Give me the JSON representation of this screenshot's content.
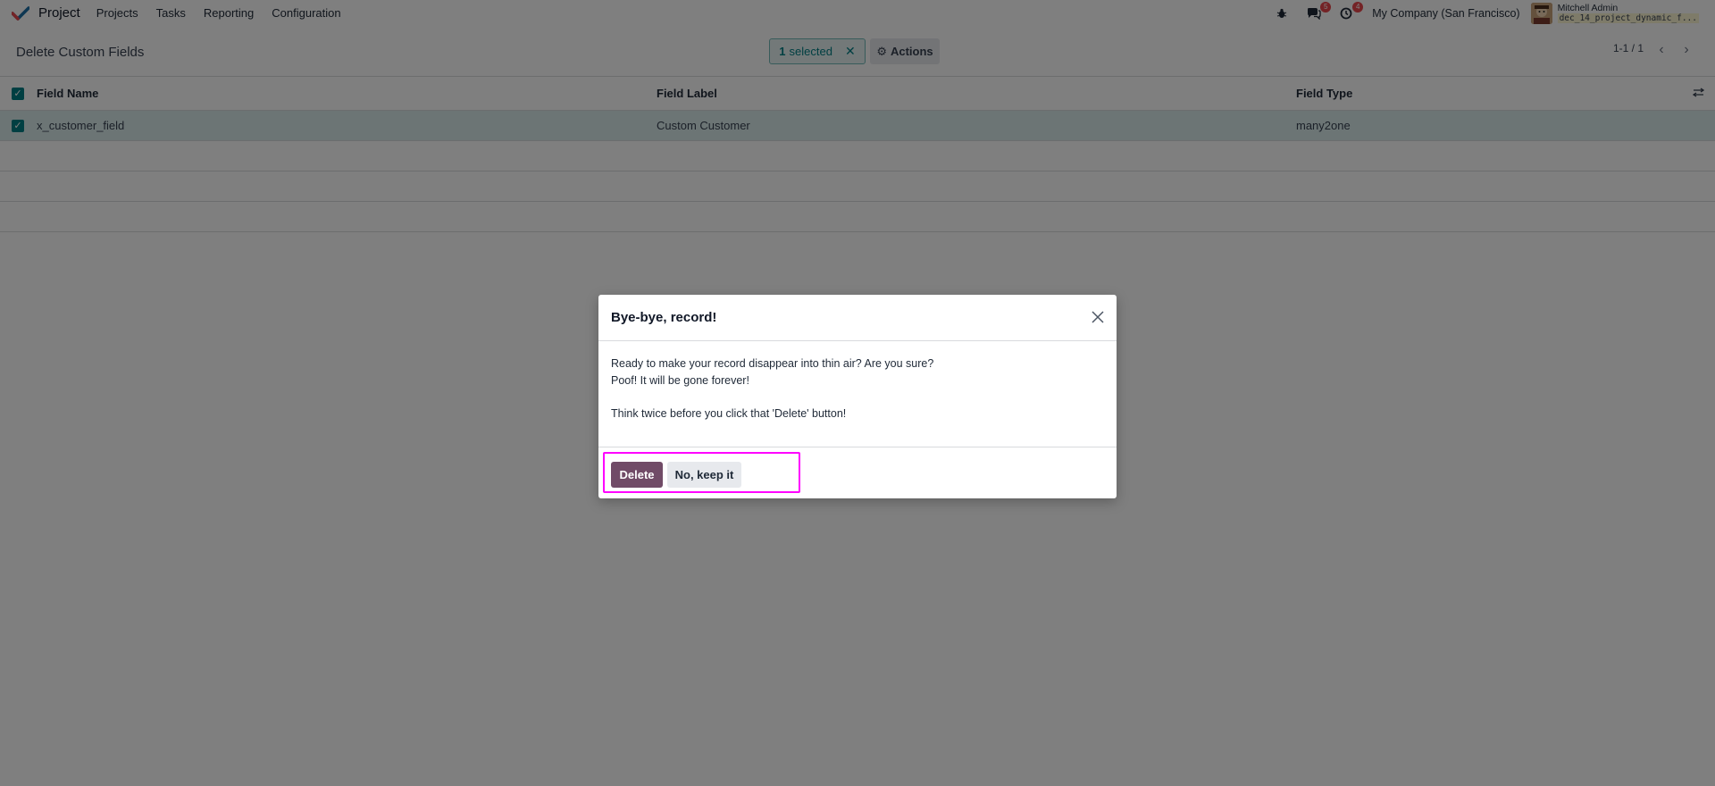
{
  "navbar": {
    "app_name": "Project",
    "menu": [
      "Projects",
      "Tasks",
      "Reporting",
      "Configuration"
    ],
    "messages_badge": "5",
    "activities_badge": "4",
    "company": "My Company (San Francisco)",
    "user_name": "Mitchell Admin",
    "db_name": "dec_14_project_dynamic_f..."
  },
  "control_panel": {
    "title": "Delete Custom Fields",
    "selected_count": "1",
    "selected_label": "selected",
    "actions_label": "Actions",
    "pager": "1-1 / 1"
  },
  "table": {
    "headers": [
      "Field Name",
      "Field Label",
      "Field Type"
    ],
    "rows": [
      {
        "name": "x_customer_field",
        "label": "Custom Customer",
        "type": "many2one"
      }
    ]
  },
  "dialog": {
    "title": "Bye-bye, record!",
    "line1": "Ready to make your record disappear into thin air? Are you sure?",
    "line2": "Poof! It will be gone forever!",
    "line3": "Think twice before you click that 'Delete' button!",
    "delete_label": "Delete",
    "keep_label": "No, keep it"
  },
  "colors": {
    "brand": "#714b67",
    "accent": "#017e84",
    "highlight": "#ff00ff"
  }
}
